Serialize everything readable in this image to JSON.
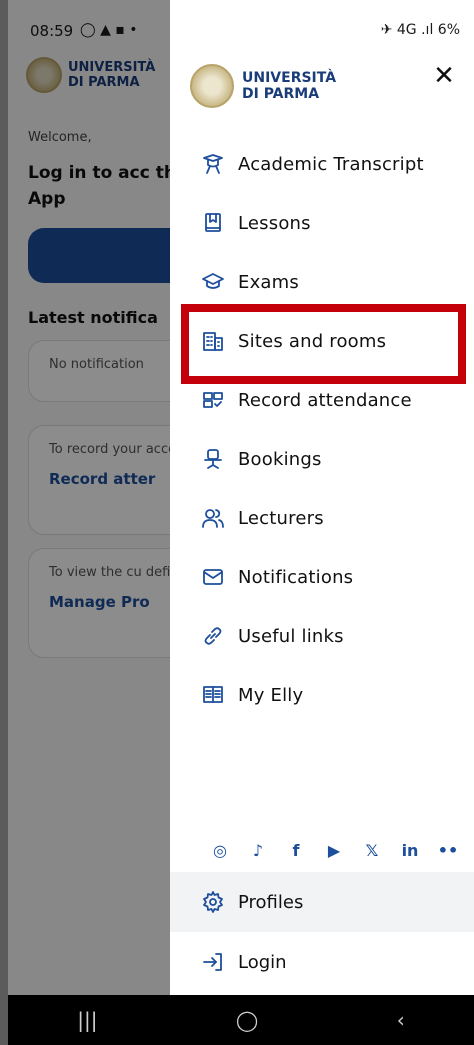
{
  "status": {
    "time": "08:59",
    "left_icons": "◯ ▲ ▪ •",
    "right_icons": "✈ 4G .ıl 6%",
    "battery": "6%"
  },
  "background": {
    "logo_line1": "UNIVERSITÀ",
    "logo_line2": "DI PARMA",
    "welcome": "Welcome,",
    "title": "Log in to acc the App",
    "latest": "Latest notifica",
    "cards": [
      {
        "text": "No notification",
        "link": ""
      },
      {
        "text": "To record your access the follo",
        "link": "Record atter"
      },
      {
        "text": "To view the cu define at least",
        "link": "Manage Pro"
      }
    ]
  },
  "drawer": {
    "logo_line1": "UNIVERSITÀ",
    "logo_line2": "DI PARMA",
    "close": "✕",
    "items": [
      {
        "label": "Academic Transcript",
        "icon": "graduation-award-icon"
      },
      {
        "label": "Lessons",
        "icon": "book-icon"
      },
      {
        "label": "Exams",
        "icon": "mortarboard-icon"
      },
      {
        "label": "Sites and rooms",
        "icon": "building-icon"
      },
      {
        "label": "Record attendance",
        "icon": "attendance-icon"
      },
      {
        "label": "Bookings",
        "icon": "desk-chair-icon"
      },
      {
        "label": "Lecturers",
        "icon": "people-icon"
      },
      {
        "label": "Notifications",
        "icon": "envelope-icon"
      },
      {
        "label": "Useful links",
        "icon": "link-icon"
      },
      {
        "label": "My Elly",
        "icon": "open-book-icon"
      }
    ],
    "social": [
      "instagram-icon",
      "tiktok-icon",
      "facebook-icon",
      "youtube-icon",
      "x-icon",
      "linkedin-icon",
      "flickr-icon"
    ],
    "profiles": "Profiles",
    "login": "Login"
  },
  "navbar": {
    "recent": "|||",
    "home": "◯",
    "back": "‹"
  },
  "colors": {
    "accent": "#1d4f9c",
    "highlight": "#c4000b"
  }
}
